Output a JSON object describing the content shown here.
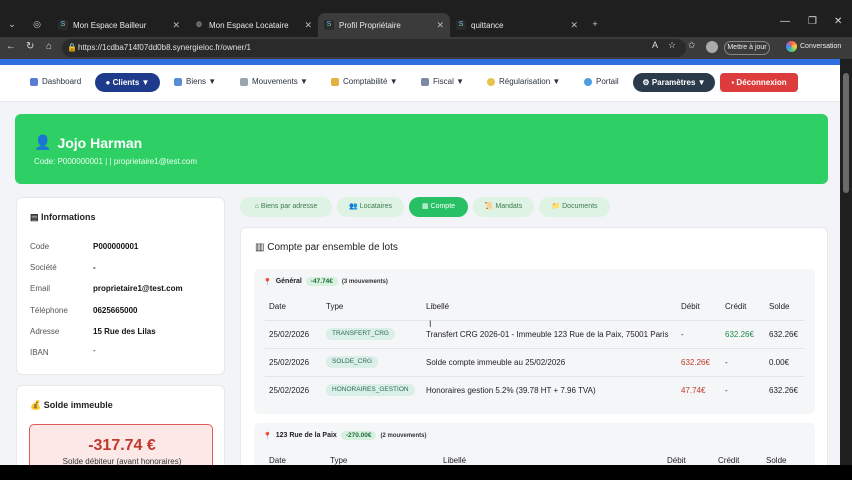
{
  "browser": {
    "tabs": [
      {
        "label": "Mon Espace Bailleur",
        "icon": "s-favicon"
      },
      {
        "label": "Mon Espace Locataire",
        "icon": "globe-favicon"
      },
      {
        "label": "Profil Propriétaire",
        "icon": "s-favicon"
      },
      {
        "label": "quittance",
        "icon": "s-favicon"
      }
    ],
    "url": "https://1cdba714f07dd0b8.synergieloc.fr/owner/1",
    "update_label": "Mettre à jour",
    "conversation_label": "Conversation"
  },
  "nav": {
    "items": [
      {
        "label": "Dashboard"
      },
      {
        "label": "Clients ▼"
      },
      {
        "label": "Biens ▼"
      },
      {
        "label": "Mouvements ▼"
      },
      {
        "label": "Comptabilité ▼"
      },
      {
        "label": "Fiscal ▼"
      },
      {
        "label": "Régularisation ▼"
      },
      {
        "label": "Portail"
      },
      {
        "label": "Paramètres ▼"
      },
      {
        "label": "Déconnexion"
      }
    ]
  },
  "owner": {
    "name": "Jojo Harman",
    "code_line": "Code: P000000001 | | proprietaire1@test.com"
  },
  "info": {
    "title": "Informations",
    "rows": [
      {
        "label": "Code",
        "value": "P000000001"
      },
      {
        "label": "Société",
        "value": "-"
      },
      {
        "label": "Email",
        "value": "proprietaire1@test.com"
      },
      {
        "label": "Téléphone",
        "value": "0625665000"
      },
      {
        "label": "Adresse",
        "value": "15 Rue des Lilas"
      },
      {
        "label": "IBAN",
        "value": "-"
      }
    ]
  },
  "solde": {
    "title": "Solde immeuble",
    "amount": "-317.74 €",
    "label": "Solde débiteur (avant honoraires)"
  },
  "chips": [
    {
      "label": "Biens par adresse"
    },
    {
      "label": "Locataires"
    },
    {
      "label": "Compte"
    },
    {
      "label": "Mandats"
    },
    {
      "label": "Documents"
    }
  ],
  "compte": {
    "title": "Compte par ensemble de lots",
    "columns": [
      "Date",
      "Type",
      "Libellé",
      "Débit",
      "Crédit",
      "Solde"
    ],
    "groups": [
      {
        "name": "Général",
        "badge": "-47.74€",
        "count": "(3 mouvements)",
        "rows": [
          {
            "date": "25/02/2026",
            "type": "TRANSFERT_CRG",
            "libelle": "Transfert CRG 2026-01 - Immeuble 123 Rue de la Paix, 75001 Paris",
            "debit": "-",
            "credit": "632.26€",
            "solde": "632.26€"
          },
          {
            "date": "25/02/2026",
            "type": "SOLDE_CRG",
            "libelle": "Solde compte immeuble au 25/02/2026",
            "debit": "632.26€",
            "credit": "-",
            "solde": "0.00€"
          },
          {
            "date": "25/02/2026",
            "type": "HONORAIRES_GESTION",
            "libelle": "Honoraires gestion 5.2% (39.78 HT + 7.96 TVA)",
            "debit": "47.74€",
            "credit": "-",
            "solde": "632.26€"
          }
        ]
      },
      {
        "name": "123 Rue de la Paix",
        "badge": "-270.00€",
        "count": "(2 mouvements)",
        "rows": []
      }
    ]
  },
  "colors": {
    "accent": "#2ed065",
    "brand_blue": "#1e3a8a",
    "danger": "#dc3c3c"
  }
}
